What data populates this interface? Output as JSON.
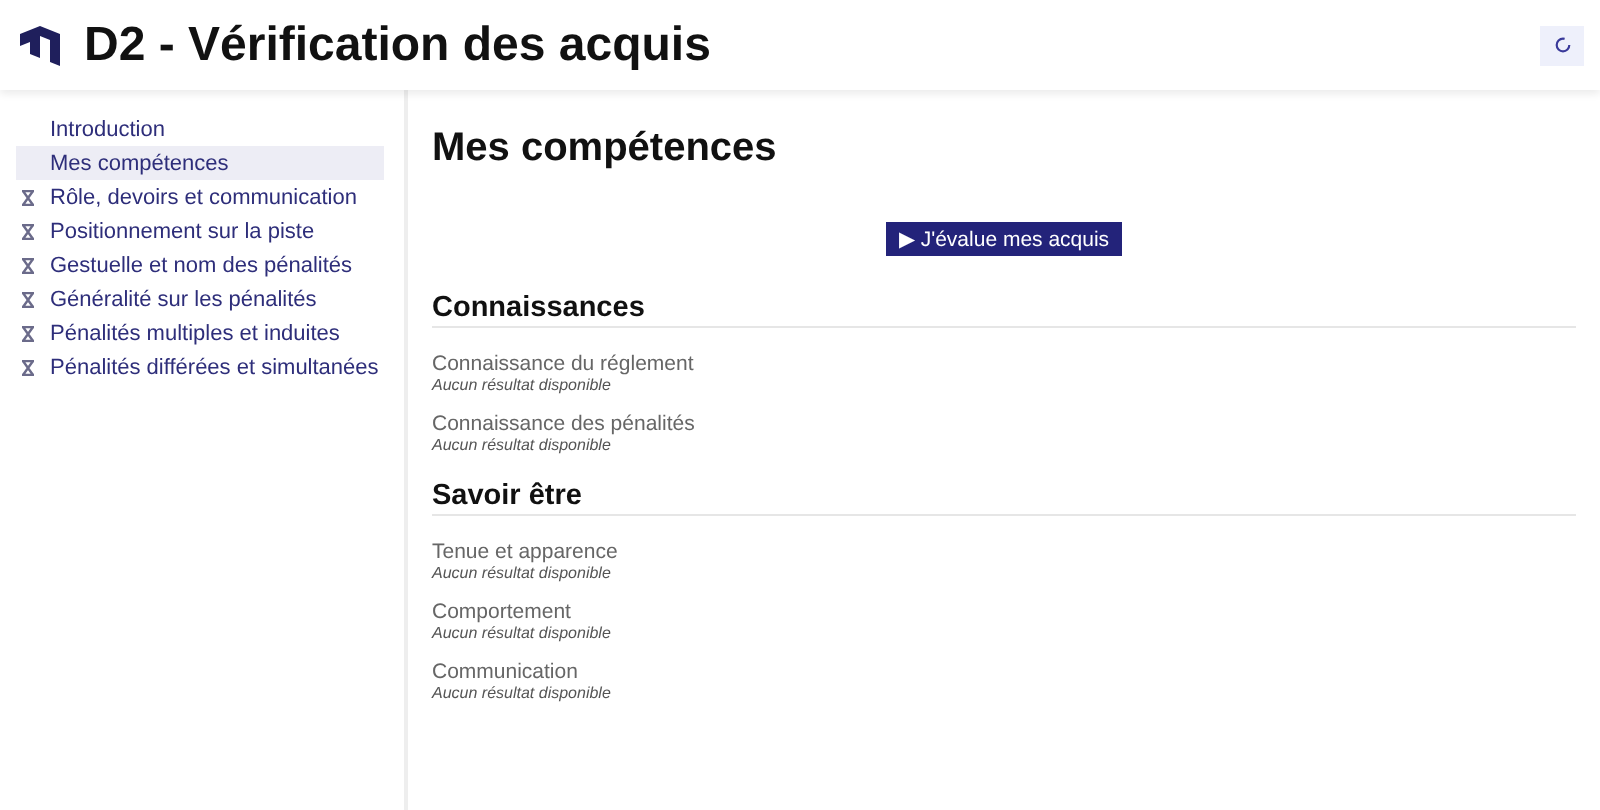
{
  "header": {
    "title": "D2 - Vérification des acquis"
  },
  "sidebar": {
    "items": [
      {
        "label": "Introduction",
        "kind": "page",
        "selected": false
      },
      {
        "label": "Mes compétences",
        "kind": "page",
        "selected": true
      },
      {
        "label": "Rôle, devoirs et communication",
        "kind": "pending",
        "selected": false
      },
      {
        "label": "Positionnement sur la piste",
        "kind": "pending",
        "selected": false
      },
      {
        "label": "Gestuelle et nom des pénalités",
        "kind": "pending",
        "selected": false
      },
      {
        "label": "Généralité sur les pénalités",
        "kind": "pending",
        "selected": false
      },
      {
        "label": "Pénalités multiples et induites",
        "kind": "pending",
        "selected": false
      },
      {
        "label": "Pénalités différées et simultanées",
        "kind": "pending",
        "selected": false
      }
    ]
  },
  "main": {
    "title": "Mes compétences",
    "action_button": "▶ J'évalue mes acquis",
    "sections": [
      {
        "title": "Connaissances",
        "skills": [
          {
            "name": "Connaissance du réglement",
            "result": "Aucun résultat disponible"
          },
          {
            "name": "Connaissance des pénalités",
            "result": "Aucun résultat disponible"
          }
        ]
      },
      {
        "title": "Savoir être",
        "skills": [
          {
            "name": "Tenue et apparence",
            "result": "Aucun résultat disponible"
          },
          {
            "name": "Comportement",
            "result": "Aucun résultat disponible"
          },
          {
            "name": "Communication",
            "result": "Aucun résultat disponible"
          }
        ]
      }
    ]
  }
}
